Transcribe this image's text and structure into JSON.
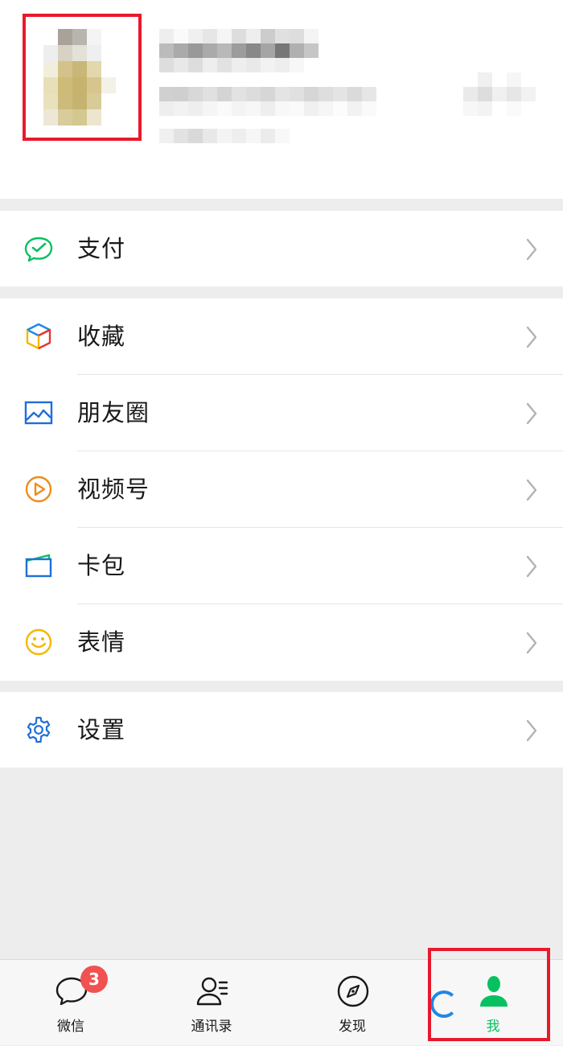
{
  "colors": {
    "accent_green": "#07c160",
    "highlight_red": "#e8192c",
    "badge_red": "#f15151",
    "text": "#191919"
  },
  "profile": {
    "avatar_icon": "pixelated-avatar"
  },
  "menu": {
    "pay": {
      "label": "支付",
      "icon": "wechat-pay-icon"
    },
    "favorites": {
      "label": "收藏",
      "icon": "cube-icon"
    },
    "moments": {
      "label": "朋友圈",
      "icon": "picture-icon"
    },
    "channels": {
      "label": "视频号",
      "icon": "play-circle-icon"
    },
    "cards": {
      "label": "卡包",
      "icon": "wallet-icon"
    },
    "stickers": {
      "label": "表情",
      "icon": "smiley-icon"
    },
    "settings": {
      "label": "设置",
      "icon": "gear-icon"
    }
  },
  "tabbar": {
    "chats": {
      "label": "微信",
      "badge": "3",
      "icon": "chat-bubble-icon"
    },
    "contacts": {
      "label": "通讯录",
      "icon": "contacts-icon"
    },
    "discover": {
      "label": "发现",
      "icon": "compass-icon"
    },
    "me": {
      "label": "我",
      "icon": "person-icon",
      "active": true
    }
  }
}
